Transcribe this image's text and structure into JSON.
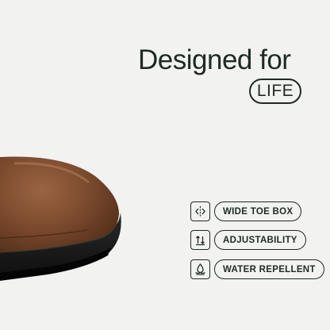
{
  "headline": {
    "line1": "Designed for",
    "pill": "LIFE"
  },
  "features": [
    {
      "icon": "wide-toe-arrows-icon",
      "label": "WIDE TOE BOX"
    },
    {
      "icon": "adjust-arrows-icon",
      "label": "ADJUSTABILITY"
    },
    {
      "icon": "water-drop-icon",
      "label": "WATER REPELLENT"
    }
  ],
  "colors": {
    "background": "#f2f2f1",
    "text": "#1f2a24",
    "leather": "#7a4a2e",
    "sole": "#1a1a1a"
  }
}
